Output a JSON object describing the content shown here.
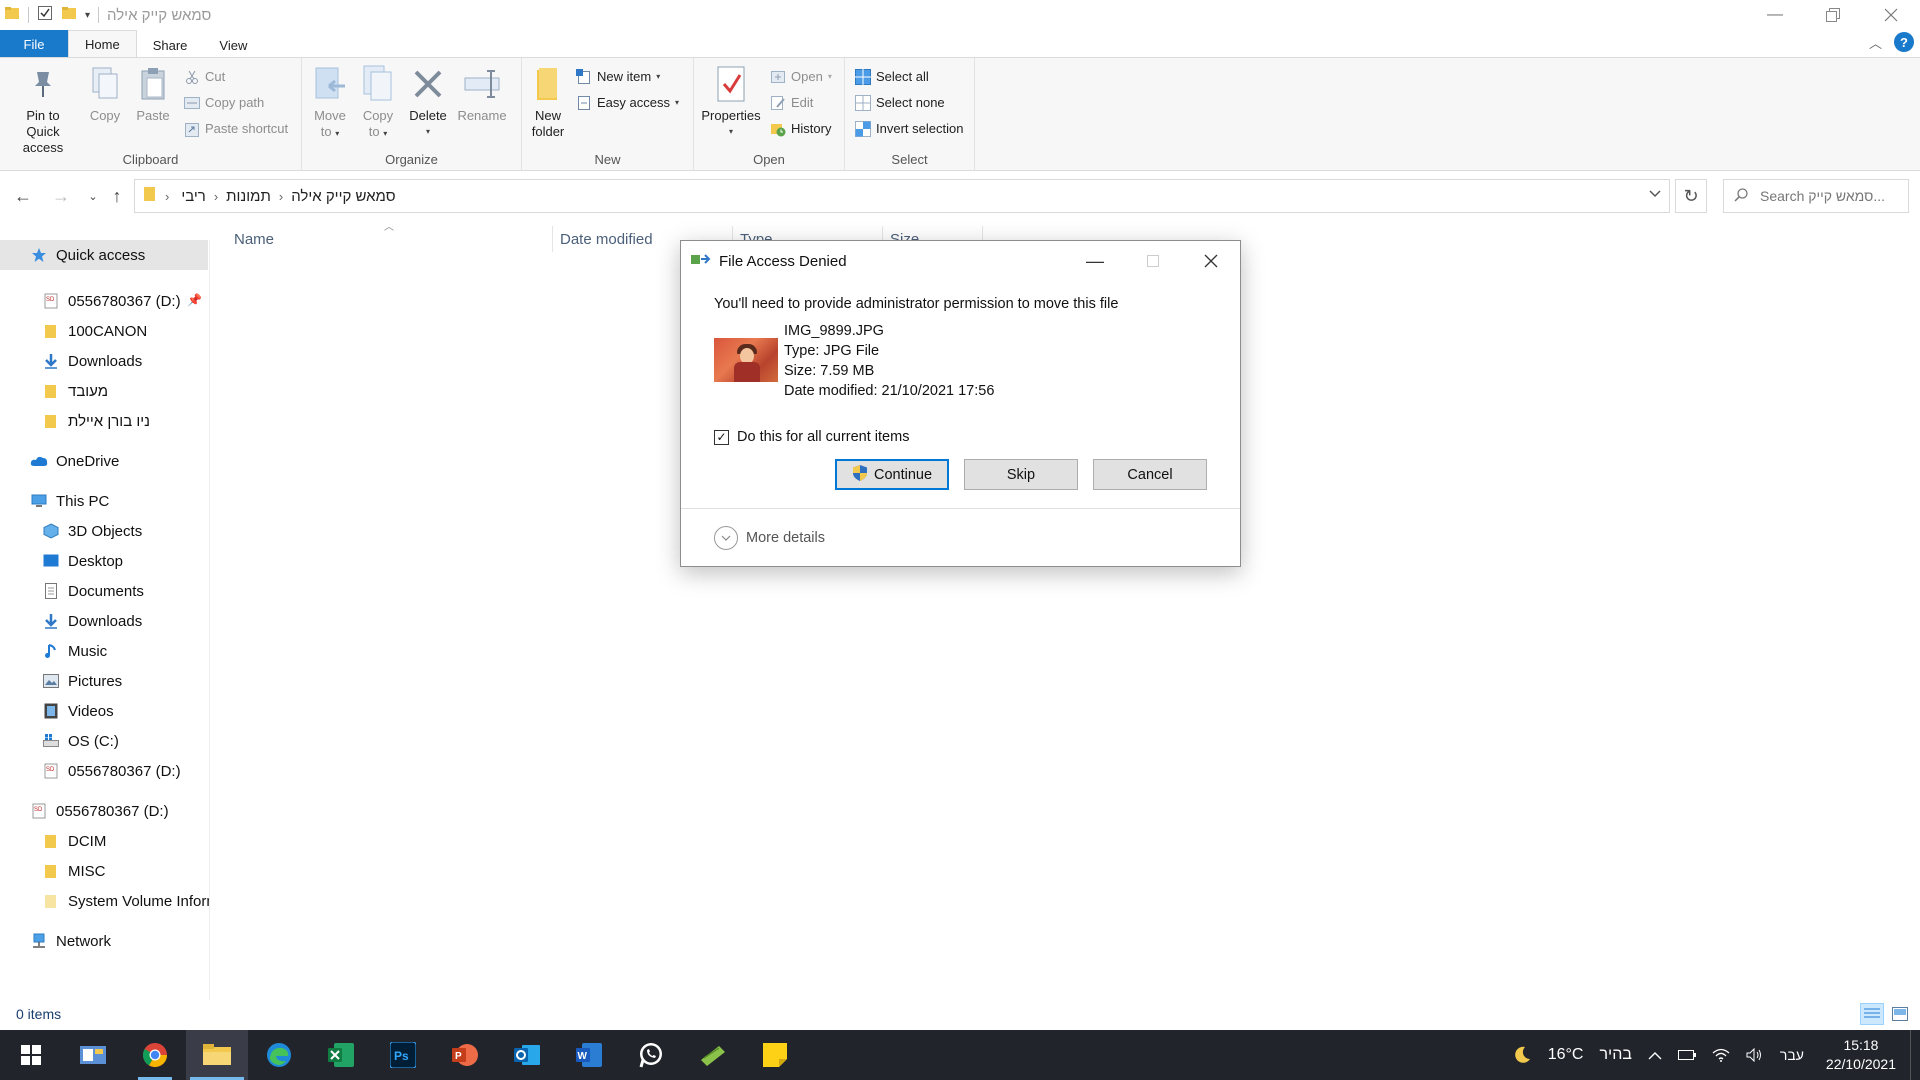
{
  "window": {
    "title": "סמאש קייק אילה"
  },
  "tabs": [
    {
      "label": "File"
    },
    {
      "label": "Home"
    },
    {
      "label": "Share"
    },
    {
      "label": "View"
    }
  ],
  "ribbon": {
    "clipboard": {
      "label": "Clipboard",
      "pin_line1": "Pin to Quick",
      "pin_line2": "access",
      "copy": "Copy",
      "paste": "Paste",
      "cut": "Cut",
      "copy_path": "Copy path",
      "paste_shortcut": "Paste shortcut"
    },
    "organize": {
      "label": "Organize",
      "move_line1": "Move",
      "move_line2": "to",
      "copyto_line1": "Copy",
      "copyto_line2": "to",
      "delete": "Delete",
      "rename": "Rename"
    },
    "new": {
      "label": "New",
      "new_folder_line1": "New",
      "new_folder_line2": "folder",
      "new_item": "New item",
      "easy_access": "Easy access"
    },
    "open": {
      "label": "Open",
      "properties": "Properties",
      "open": "Open",
      "edit": "Edit",
      "history": "History"
    },
    "select": {
      "label": "Select",
      "select_all": "Select all",
      "select_none": "Select none",
      "invert_selection": "Invert selection"
    }
  },
  "address": {
    "crumbs": [
      "ריבי",
      "תמונות",
      "סמאש קייק אילה"
    ],
    "search_placeholder": "Search סמאש קייק..."
  },
  "navpane": {
    "quick_access": "Quick access",
    "qa_items": [
      "0556780367 (D:)",
      "100CANON",
      "Downloads",
      "מעובד",
      "ניו בורן איילת"
    ],
    "onedrive": "OneDrive",
    "this_pc": "This PC",
    "pc_items": [
      "3D Objects",
      "Desktop",
      "Documents",
      "Downloads",
      "Music",
      "Pictures",
      "Videos",
      "OS (C:)",
      "0556780367 (D:)"
    ],
    "drive": "0556780367 (D:)",
    "drive_items": [
      "DCIM",
      "MISC",
      "System Volume Inforn"
    ],
    "network": "Network"
  },
  "columns": {
    "name": "Name",
    "date_modified": "Date modified",
    "type": "Type",
    "size": "Size"
  },
  "status": {
    "items": "0 items"
  },
  "dialog": {
    "title": "File Access Denied",
    "message": "You'll need to provide administrator permission to move this file",
    "file_name": "IMG_9899.JPG",
    "file_type": "Type: JPG File",
    "file_size": "Size: 7.59 MB",
    "file_date": "Date modified: 21/10/2021 17:56",
    "checkbox_label": "Do this for all current items",
    "checkbox_checked": true,
    "continue": "Continue",
    "skip": "Skip",
    "cancel": "Cancel",
    "more_details": "More details"
  },
  "taskbar": {
    "apps": [
      "start",
      "explorer-alt",
      "chrome",
      "file-explorer",
      "edge",
      "excel",
      "photoshop",
      "powerpoint",
      "outlook",
      "word",
      "whatsapp",
      "android-file",
      "sticky-notes"
    ],
    "weather_temp": "16°C",
    "weather_text": "בהיר",
    "lang": "עבר",
    "time": "15:18",
    "date": "22/10/2021"
  },
  "colors": {
    "accent": "#1979ca",
    "taskbar": "#22242c",
    "selection": "#e5e5e5"
  }
}
